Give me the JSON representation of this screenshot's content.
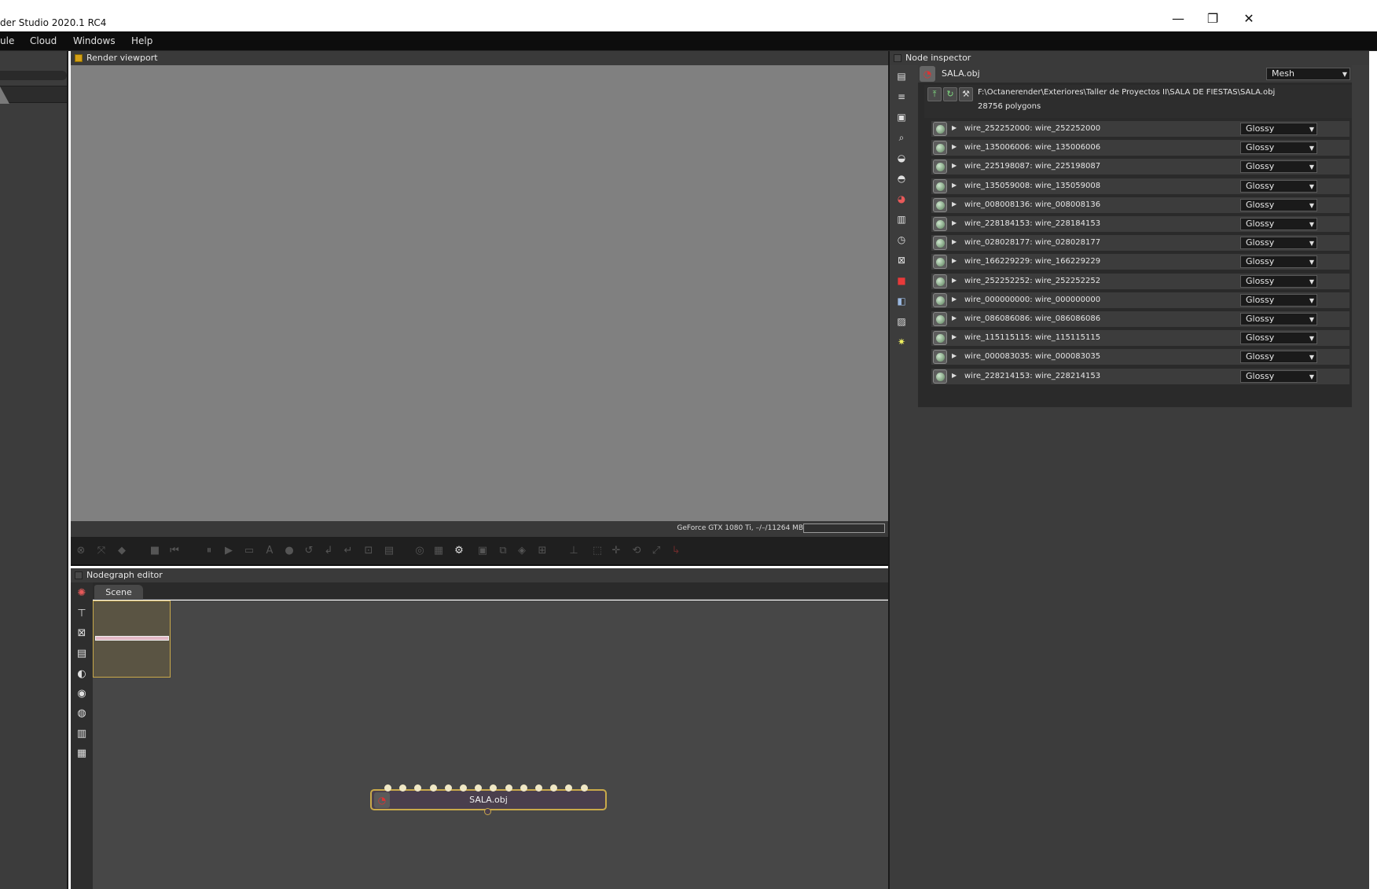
{
  "window": {
    "title": "der Studio 2020.1 RC4",
    "controls": {
      "minimize": "—",
      "restore": "❐",
      "close": "✕"
    }
  },
  "menu": [
    "ule",
    "Cloud",
    "Windows",
    "Help"
  ],
  "render_viewport": {
    "title": "Render viewport",
    "status": "GeForce GTX 1080 Ti, –/–/11264 MB"
  },
  "nodegraph": {
    "title": "Nodegraph editor",
    "tab": "Scene",
    "node_label": "SALA.obj",
    "pin_count": 14
  },
  "inspector": {
    "title": "Node inspector",
    "object_name": "SALA.obj",
    "object_type": "Mesh",
    "file_path": "F:\\Octanerender\\Exteriores\\Taller de Proyectos II\\SALA DE FIESTAS\\SALA.obj",
    "polygons": "28756 polygons",
    "materials": [
      {
        "name": "wire_252252000: wire_252252000",
        "type": "Glossy"
      },
      {
        "name": "wire_135006006: wire_135006006",
        "type": "Glossy"
      },
      {
        "name": "wire_225198087: wire_225198087",
        "type": "Glossy"
      },
      {
        "name": "wire_135059008: wire_135059008",
        "type": "Glossy"
      },
      {
        "name": "wire_008008136: wire_008008136",
        "type": "Glossy"
      },
      {
        "name": "wire_228184153: wire_228184153",
        "type": "Glossy"
      },
      {
        "name": "wire_028028177: wire_028028177",
        "type": "Glossy"
      },
      {
        "name": "wire_166229229: wire_166229229",
        "type": "Glossy"
      },
      {
        "name": "wire_252252252: wire_252252252",
        "type": "Glossy"
      },
      {
        "name": "wire_000000000: wire_000000000",
        "type": "Glossy"
      },
      {
        "name": "wire_086086086: wire_086086086",
        "type": "Glossy"
      },
      {
        "name": "wire_115115115: wire_115115115",
        "type": "Glossy"
      },
      {
        "name": "wire_000083035: wire_000083035",
        "type": "Glossy"
      },
      {
        "name": "wire_228214153: wire_228214153",
        "type": "Glossy"
      }
    ]
  },
  "colors": {
    "viewport_bg": "#808080",
    "accent_gold": "#c9a94a",
    "panel_bg": "#3c3c3c"
  }
}
